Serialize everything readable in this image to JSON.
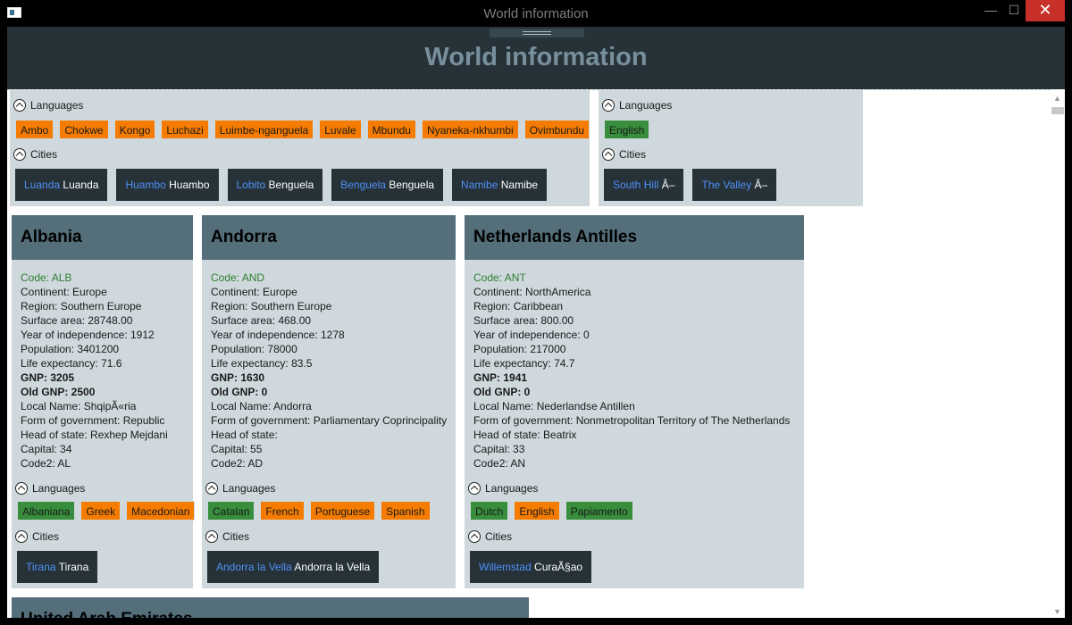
{
  "window": {
    "title": "World information",
    "minimize": "—",
    "maximize": "☐",
    "close": "✕"
  },
  "header": {
    "title": "World information"
  },
  "labels": {
    "languages": "Languages",
    "cities": "Cities",
    "code": "Code: ",
    "continent": "Continent: ",
    "region": "Region: ",
    "surface": "Surface area: ",
    "independence": "Year of independence: ",
    "population": "Population: ",
    "life": "Life expectancy: ",
    "gnp": "GNP: ",
    "oldgnp": "Old GNP: ",
    "localname": "Local Name: ",
    "government": "Form of government: ",
    "head": "Head of state: ",
    "capital": "Capital: ",
    "code2": "Code2: "
  },
  "angola_partial": {
    "languages": [
      "Ambo",
      "Chokwe",
      "Kongo",
      "Luchazi",
      "Luimbe-nganguela",
      "Luvale",
      "Mbundu",
      "Nyaneka-nkhumbi",
      "Ovimbundu"
    ],
    "cities": [
      {
        "name": "Luanda",
        "district": "Luanda"
      },
      {
        "name": "Huambo",
        "district": "Huambo"
      },
      {
        "name": "Lobito",
        "district": "Benguela"
      },
      {
        "name": "Benguela",
        "district": "Benguela"
      },
      {
        "name": "Namibe",
        "district": "Namibe"
      }
    ]
  },
  "anguilla_partial": {
    "languages": [
      "English"
    ],
    "cities": [
      {
        "name": "South Hill",
        "district": "Â–"
      },
      {
        "name": "The Valley",
        "district": "Â–"
      }
    ]
  },
  "countries": [
    {
      "name": "Albania",
      "code": "ALB",
      "continent": "Europe",
      "region": "Southern Europe",
      "surface": "28748.00",
      "independence": "1912",
      "population": "3401200",
      "life": "71.6",
      "gnp": "3205",
      "oldgnp": "2500",
      "localname": "ShqipÃ«ria",
      "government": "Republic",
      "head": "Rexhep Mejdani",
      "capital": "34",
      "code2": "AL",
      "languages": [
        {
          "name": "Albaniana",
          "official": true
        },
        {
          "name": "Greek",
          "official": false
        },
        {
          "name": "Macedonian",
          "official": false
        }
      ],
      "cities": [
        {
          "name": "Tirana",
          "district": "Tirana"
        }
      ]
    },
    {
      "name": "Andorra",
      "code": "AND",
      "continent": "Europe",
      "region": "Southern Europe",
      "surface": "468.00",
      "independence": "1278",
      "population": "78000",
      "life": "83.5",
      "gnp": "1630",
      "oldgnp": "0",
      "localname": "Andorra",
      "government": "Parliamentary Coprincipality",
      "head": "",
      "capital": "55",
      "code2": "AD",
      "languages": [
        {
          "name": "Catalan",
          "official": true
        },
        {
          "name": "French",
          "official": false
        },
        {
          "name": "Portuguese",
          "official": false
        },
        {
          "name": "Spanish",
          "official": false
        }
      ],
      "cities": [
        {
          "name": "Andorra la Vella",
          "district": "Andorra la Vella"
        }
      ]
    },
    {
      "name": "Netherlands Antilles",
      "code": "ANT",
      "continent": "NorthAmerica",
      "region": "Caribbean",
      "surface": "800.00",
      "independence": "0",
      "population": "217000",
      "life": "74.7",
      "gnp": "1941",
      "oldgnp": "0",
      "localname": "Nederlandse Antillen",
      "government": "Nonmetropolitan Territory of The Netherlands",
      "head": "Beatrix",
      "capital": "33",
      "code2": "AN",
      "languages": [
        {
          "name": "Dutch",
          "official": true
        },
        {
          "name": "English",
          "official": false
        },
        {
          "name": "Papiamento",
          "official": true
        }
      ],
      "cities": [
        {
          "name": "Willemstad",
          "district": "CuraÃ§ao"
        }
      ]
    },
    {
      "name": "United Arab Emirates"
    }
  ],
  "colors": {
    "header": "#263238",
    "card": "#cfd8dc",
    "card_head": "#546e7a",
    "official": "#388e3c",
    "unofficial": "#f57c00",
    "city_bg": "#263238",
    "city_name": "#4f8ff7",
    "code": "#2e7d32"
  }
}
